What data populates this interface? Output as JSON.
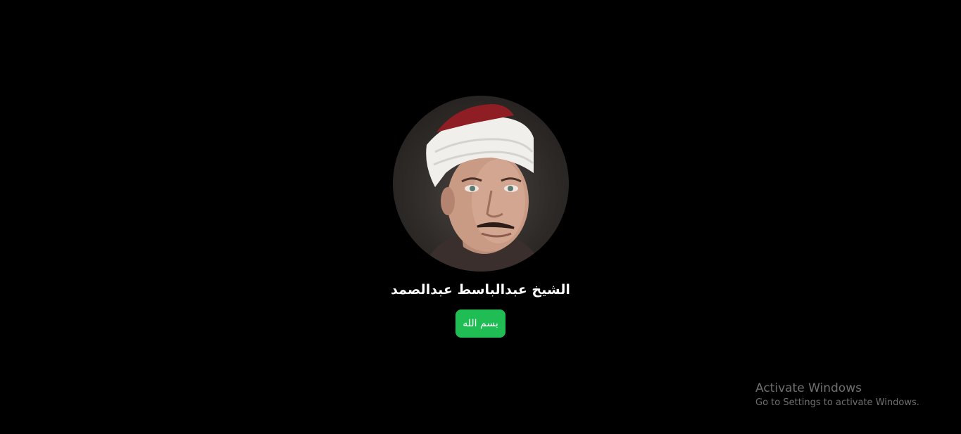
{
  "profile": {
    "photo_icon": "reciter-portrait",
    "name": "الشيخ عبدالباسط عبدالصمد",
    "button_label": "بسم الله",
    "button_color": "#1fbd54"
  },
  "watermark": {
    "title": "Activate Windows",
    "subtitle": "Go to Settings to activate Windows."
  }
}
